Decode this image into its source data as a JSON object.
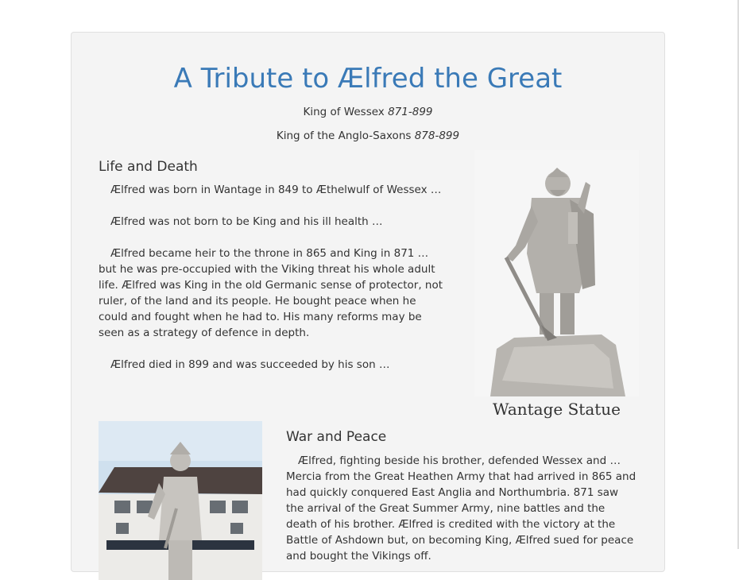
{
  "title": "A Tribute to Ælfred the Great",
  "subtitles": [
    {
      "label": "King of Wessex",
      "years": "871-899"
    },
    {
      "label": "King of the Anglo-Saxons",
      "years": "878-899"
    }
  ],
  "life": {
    "heading": "Life and Death",
    "p1": "Ælfred was born in Wantage in 849 to Æthelwulf of Wessex …",
    "p2": "Ælfred was not born to be King and his ill health …",
    "p3_first": "Ælfred became heir to the throne in 865 and King in 871 …",
    "p3_rest": "but he was pre-occupied with the Viking threat his whole adult life. Ælfred was King in the old Germanic sense of protector, not ruler, of the land and its people. He bought peace when he could and fought when he had to. His many reforms may be seen as a strategy of defence in depth.",
    "p4": "Ælfred died in 899 and was succeeded by his son …"
  },
  "statue": {
    "caption": "Wantage Statue",
    "image_icon": "statue-photo"
  },
  "war": {
    "heading": "War and Peace",
    "p1_first": "Ælfred, fighting beside his brother, defended Wessex and …",
    "p1_rest": "Mercia from the Great Heathen Army that had arrived in 865 and had quickly conquered East Anglia and Northumbria. 871 saw the arrival of the Great Summer Army, nine battles and the death of his brother. Ælfred is credited with the victory at the Battle of Ashdown but, on becoming King, Ælfred sued for peace and bought the Vikings off."
  },
  "second_photo": {
    "image_icon": "town-statue-photo"
  },
  "colors": {
    "title": "#3a7ab7",
    "card_bg": "#f4f4f4",
    "text": "#333333"
  }
}
